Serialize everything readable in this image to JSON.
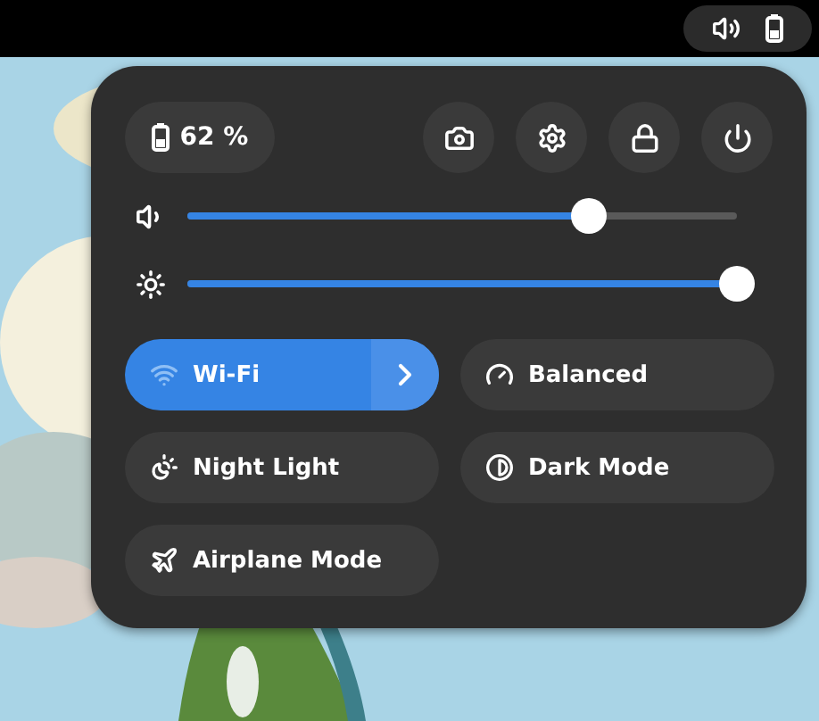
{
  "status": {
    "battery": "62 %"
  },
  "actions": [
    {
      "kind": "screenshot"
    },
    {
      "kind": "settings"
    },
    {
      "kind": "lock"
    },
    {
      "kind": "power"
    }
  ],
  "sliders": [
    {
      "kind": "volume",
      "level": 0.73
    },
    {
      "kind": "brightness",
      "level": 1
    }
  ],
  "toggles": [
    {
      "label": "Wi-Fi",
      "on": true,
      "kind": "split"
    },
    {
      "label": "Balanced",
      "on": false,
      "kind": "plain"
    },
    {
      "label": "Night Light",
      "on": false,
      "kind": "plain"
    },
    {
      "label": "Dark Mode",
      "on": false,
      "kind": "plain"
    },
    {
      "label": "Airplane Mode",
      "on": false,
      "kind": "plain"
    }
  ]
}
